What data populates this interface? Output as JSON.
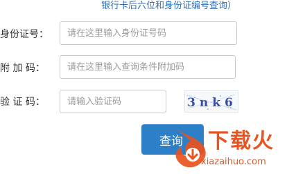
{
  "header": {
    "hint": "银行卡后六位和身份证编号查询）"
  },
  "form": {
    "id_number": {
      "label": "身份证号：",
      "placeholder": "请在这里输入身份证号码",
      "value": ""
    },
    "extra_code": {
      "label": "附 加 码：",
      "placeholder": "请在这里输入查询条件附加码",
      "value": ""
    },
    "captcha": {
      "label": "验 证 码：",
      "placeholder": "请输入验证码",
      "value": "",
      "image_text": "3nk6"
    },
    "submit_label": "查询"
  },
  "watermark": {
    "brand": "下载火",
    "domain": "xiazaihuo.com",
    "icon": "fire-logo-icon",
    "color": "#e8531f"
  },
  "colors": {
    "accent_blue": "#2d80c8",
    "hint_blue": "#2d6fb5",
    "captcha_text": "#3a4fa8"
  }
}
